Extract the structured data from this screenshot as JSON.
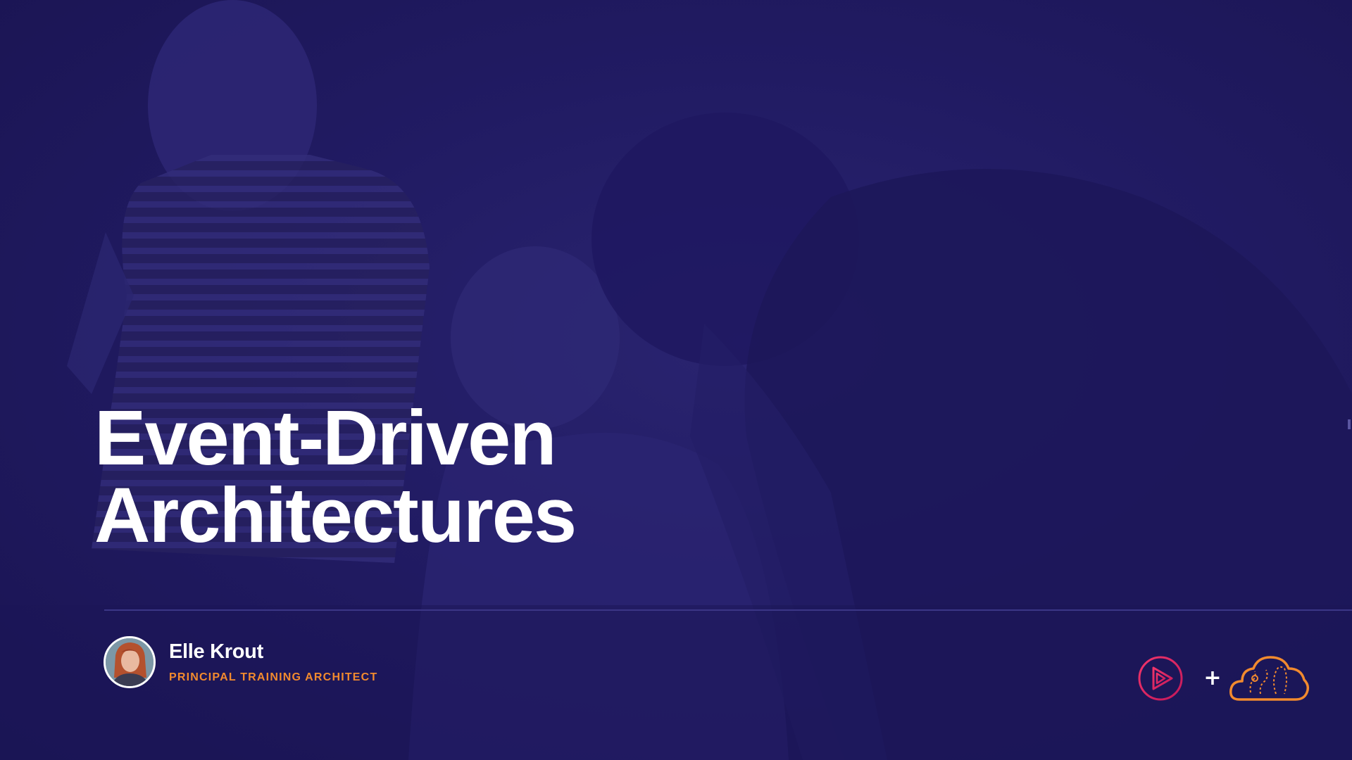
{
  "slide": {
    "title_line1": "Event-Driven",
    "title_line2": "Architectures"
  },
  "presenter": {
    "name": "Elle Krout",
    "role": "PRINCIPAL TRAINING ARCHITECT",
    "avatar_icon": "presenter-photo"
  },
  "branding": {
    "play_logo_icon": "play-logo-icon",
    "plus_symbol": "+",
    "cloud_logo_icon": "cloud-logo-icon"
  },
  "colors": {
    "background": "#1c1657",
    "title_text": "#ffffff",
    "role_accent": "#f28a2e",
    "divider": "#3b3686",
    "play_logo_gradient_start": "#f2356a",
    "play_logo_gradient_end": "#c2185b",
    "cloud_logo": "#f28a2e"
  }
}
